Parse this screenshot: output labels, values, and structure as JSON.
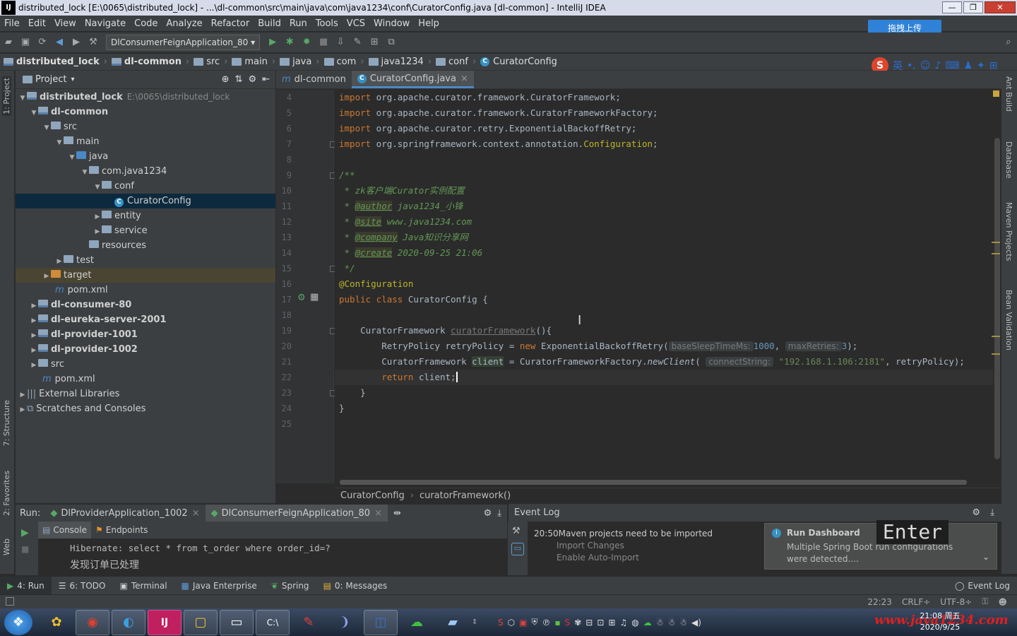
{
  "window": {
    "title": "distributed_lock [E:\\0065\\distributed_lock] - ...\\dl-common\\src\\main\\java\\com\\java1234\\conf\\CuratorConfig.java [dl-common] - IntelliJ IDEA",
    "app_icon": "IJ",
    "minimize": "—",
    "maximize": "❐",
    "close": "✕"
  },
  "menu": [
    "File",
    "Edit",
    "View",
    "Navigate",
    "Code",
    "Analyze",
    "Refactor",
    "Build",
    "Run",
    "Tools",
    "VCS",
    "Window",
    "Help"
  ],
  "upload_button": "拖拽上传",
  "toolbar": {
    "run_config": "DlConsumerFeignApplication_80",
    "icons": [
      "open-icon",
      "save-icon",
      "sync-icon",
      "back-icon",
      "forward-icon",
      "run-icon",
      "debug-icon",
      "coverage-icon",
      "stop-icon",
      "build-icon",
      "sdk-icon",
      "structure-icon",
      "search-icon"
    ]
  },
  "breadcrumbs": [
    "distributed_lock",
    "dl-common",
    "src",
    "main",
    "java",
    "com",
    "java1234",
    "conf",
    "CuratorConfig"
  ],
  "ime": {
    "lang": "英",
    "marks": "•,"
  },
  "left_stripe": [
    "1: Project",
    "7: Structure",
    "2: Favorites",
    "Web"
  ],
  "right_stripe": [
    "Ant Build",
    "Database",
    "Maven Projects",
    "Bean Validation"
  ],
  "project": {
    "header": "Project",
    "tree": [
      {
        "label": "distributed_lock",
        "path": "E:\\0065\\distributed_lock",
        "bold": true
      },
      {
        "label": "dl-common",
        "bold": true
      },
      {
        "label": "src"
      },
      {
        "label": "main"
      },
      {
        "label": "java"
      },
      {
        "label": "com.java1234"
      },
      {
        "label": "conf"
      },
      {
        "label": "CuratorConfig"
      },
      {
        "label": "entity"
      },
      {
        "label": "service"
      },
      {
        "label": "resources"
      },
      {
        "label": "test"
      },
      {
        "label": "target"
      },
      {
        "label": "pom.xml"
      },
      {
        "label": "dl-consumer-80",
        "bold": true
      },
      {
        "label": "dl-eureka-server-2001",
        "bold": true
      },
      {
        "label": "dl-provider-1001",
        "bold": true
      },
      {
        "label": "dl-provider-1002",
        "bold": true
      },
      {
        "label": "src"
      },
      {
        "label": "pom.xml"
      },
      {
        "label": "External Libraries"
      },
      {
        "label": "Scratches and Consoles"
      }
    ]
  },
  "editor": {
    "tabs": [
      {
        "label": "dl-common"
      },
      {
        "label": "CuratorConfig.java",
        "close": "×"
      }
    ],
    "line_numbers": [
      "4",
      "5",
      "6",
      "7",
      "8",
      "9",
      "10",
      "11",
      "12",
      "13",
      "14",
      "15",
      "16",
      "17",
      "18",
      "19",
      "20",
      "21",
      "22",
      "23",
      "24",
      "25"
    ],
    "code": {
      "l4_kw": "import",
      "l4_rest": " org.apache.curator.framework.CuratorFramework;",
      "l5_kw": "import",
      "l5_rest": " org.apache.curator.framework.CuratorFrameworkFactory;",
      "l6_kw": "import",
      "l6_rest": " org.apache.curator.retry.ExponentialBackoffRetry;",
      "l7_kw": "import",
      "l7_rest": " org.springframework.context.annotation.",
      "l7_cls": "Configuration",
      "l7_end": ";",
      "l9": "/**",
      "l10": " * zk客户端Curator实例配置",
      "l11_pre": " * ",
      "l11_tag": "@author",
      "l11_val": " java1234_小锋",
      "l12_pre": " * ",
      "l12_tag": "@site",
      "l12_val": " www.java1234.com",
      "l13_pre": " * ",
      "l13_tag": "@company",
      "l13_val": " Java知识分享网",
      "l14_pre": " * ",
      "l14_tag": "@create",
      "l14_val": " 2020-09-25 21:06",
      "l15": " */",
      "l16": "@Configuration",
      "l17_kw": "public class",
      "l17_rest": " CuratorConfig {",
      "l19_type": "    CuratorFramework ",
      "l19_fn": "curatorFramework",
      "l19_end": "(){",
      "l20_a": "        RetryPolicy retryPolicy = ",
      "l20_new": "new",
      "l20_b": " ExponentialBackoffRetry(",
      "l20_h1": "baseSleepTimeMs:",
      "l20_n1": "1000",
      "l20_c": ", ",
      "l20_h2": "maxRetries:",
      "l20_n2": "3",
      "l20_end": ");",
      "l21_a": "        CuratorFramework ",
      "l21_var": "client",
      "l21_b": " = CuratorFrameworkFactory.",
      "l21_m": "newClient",
      "l21_c": "( ",
      "l21_h": "connectString:",
      "l21_s": "\"192.168.1.106:2181\"",
      "l21_end": ", retryPolicy);",
      "l22_kw": "        return",
      "l22_rest": " client;",
      "l23": "    }",
      "l24": "}"
    },
    "breadcrumb": [
      "CuratorConfig",
      "curatorFramework()"
    ]
  },
  "run": {
    "label": "Run:",
    "tabs": [
      "DlProviderApplication_1002",
      "DlConsumerFeignApplication_80"
    ],
    "console_tabs": [
      "Console",
      "Endpoints"
    ],
    "lines": [
      "Hibernate: select * from t_order where order_id=?",
      "发现订单已处理"
    ]
  },
  "event_log": {
    "title": "Event Log",
    "time": "20:50",
    "message": "Maven projects need to be imported",
    "links": [
      "Import Changes",
      "Enable Auto-Import"
    ],
    "balloon": {
      "title": "Run Dashboard",
      "text": "Multiple Spring Boot run configurations were detected...."
    },
    "key_overlay": "Enter"
  },
  "bottom_tools": [
    {
      "label": "4: Run",
      "icon": "run-icon"
    },
    {
      "label": "6: TODO",
      "icon": "todo-icon"
    },
    {
      "label": "Terminal",
      "icon": "terminal-icon"
    },
    {
      "label": "Java Enterprise",
      "icon": "javaee-icon"
    },
    {
      "label": "Spring",
      "icon": "spring-icon"
    },
    {
      "label": "0: Messages",
      "icon": "messages-icon"
    }
  ],
  "event_log_button": "Event Log",
  "status": {
    "position": "22:23",
    "line_sep": "CRLF÷",
    "encoding": "UTF-8÷"
  },
  "taskbar": {
    "apps": [
      "start-orb",
      "pinwheel-app",
      "chrome",
      "edge-browser",
      "intellij-idea",
      "file-manager",
      "window-app",
      "cmd-terminal",
      "pen-app",
      "tool-app",
      "navicat",
      "wechat",
      "notes-app"
    ],
    "clock_time": "21:08 周五",
    "clock_date": "2020/9/25",
    "watermark": "www.java1234.com"
  },
  "colors": {
    "accent": "#4a88c7",
    "keyword": "#cc7832",
    "annotation": "#bbb529",
    "comment": "#629755",
    "string": "#6a8759",
    "number": "#6897bb"
  }
}
